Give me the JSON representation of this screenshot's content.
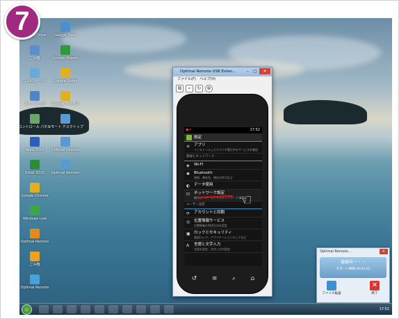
{
  "step_number": "7",
  "desktop_icons": [
    {
      "label": "Google Drive",
      "color": "#3c8fd0"
    },
    {
      "label": "ごみ箱",
      "color": "#5b8fcb"
    },
    {
      "label": "コンピューター",
      "color": "#6aa9d8"
    },
    {
      "label": "ネットワーク",
      "color": "#4f86c4"
    },
    {
      "label": "コントロール パネル",
      "color": "#6ca56a"
    },
    {
      "label": "Word 2010",
      "color": "#2b5fb8"
    },
    {
      "label": "Excel 2010",
      "color": "#2f8a3c"
    },
    {
      "label": "Google Chrome",
      "color": "#e0b020"
    },
    {
      "label": "Windows Live",
      "color": "#3fa54a"
    },
    {
      "label": "Optimal Remote",
      "color": "#e08a20"
    },
    {
      "label": "ごみ箱",
      "color": "#f0a020"
    },
    {
      "label": "Optimal Remote",
      "color": "#4aa0d8"
    }
  ],
  "desktop_icons_right": [
    {
      "label": "Google Docs",
      "color": "#4a8fd0"
    },
    {
      "label": "Google Sheets",
      "color": "#2f9a3c"
    },
    {
      "label": "Google Slides",
      "color": "#e0b020"
    },
    {
      "label": "Google ドライブ",
      "color": "#e0b020"
    },
    {
      "label": "リモート デスクトップ",
      "color": "#5a9ad0"
    },
    {
      "label": "Optimal Remote",
      "color": "#5a9ad0"
    },
    {
      "label": "Optimal Remote",
      "color": "#5a9ad0"
    }
  ],
  "window": {
    "title": "Optimal Remote USB Exten...",
    "menu": [
      "ファイル(F)",
      "ヘルプ(H)"
    ],
    "close": "✕"
  },
  "phone": {
    "time": "17:52",
    "header": "設定",
    "rows": [
      {
        "icon": "≡",
        "title": "アプリ",
        "sub": "インストールしたアプリや実行中のサービスを確認"
      },
      {
        "section": "無線とネットワーク"
      },
      {
        "icon": "◈",
        "title": "Wi-Fi",
        "sub": ""
      },
      {
        "icon": "✱",
        "title": "Bluetooth",
        "sub": "接続、端末名、検出の許可など"
      },
      {
        "icon": "◐",
        "title": "データ使用",
        "sub": ""
      },
      {
        "icon": "⊡",
        "title": "ネットワーク設定",
        "sub": "機内モード、モバイルネットワークなど"
      },
      {
        "section": "ユーザー設定"
      },
      {
        "icon": "⟳",
        "title": "アカウントと同期",
        "sub": ""
      },
      {
        "icon": "◎",
        "title": "位置情報サービス",
        "sub": "位置情報の利用方法を設定"
      },
      {
        "icon": "▣",
        "title": "ロックとセキュリティ",
        "sub": "画面ロック、アプリケーションロックなど"
      },
      {
        "icon": "A",
        "title": "言語と文字入力",
        "sub": "言語を設定、文字入力の設定"
      }
    ]
  },
  "taskbar": {
    "clock": "17:52"
  },
  "popup": {
    "title": "Optimal Remote...",
    "status": "接続中・・・",
    "session_label": "サポート時間",
    "session_time": "00:04:22",
    "file_transfer": "ファイル転送",
    "exit": "終了"
  }
}
